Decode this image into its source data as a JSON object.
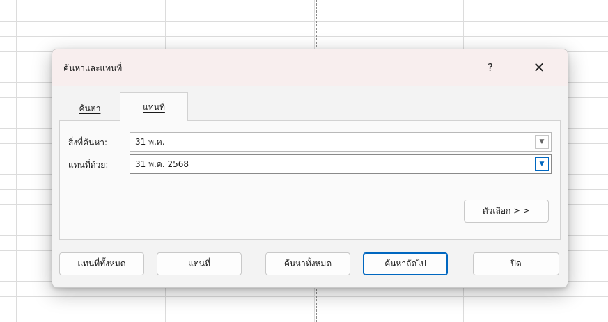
{
  "dialog": {
    "title": "ค้นหาและแทนที่",
    "help_label": "?",
    "close_label": "✕"
  },
  "tabs": [
    {
      "label": "ค้นหา",
      "active": false
    },
    {
      "label": "แทนที่",
      "active": true
    }
  ],
  "find": {
    "label": "สิ่งที่ค้นหา:",
    "value": "31 พ.ค."
  },
  "replace": {
    "label": "แทนที่ด้วย:",
    "value": "31 พ.ค. 2568"
  },
  "options_button": "ตัวเลือก > >",
  "buttons": {
    "replace_all": "แทนที่ทั้งหมด",
    "replace": "แทนที่",
    "find_all": "ค้นหาทั้งหมด",
    "find_next": "ค้นหาถัดไป",
    "close": "ปิด"
  },
  "icons": {
    "dropdown": "chevron-down-icon",
    "close": "close-icon",
    "help": "help-icon"
  },
  "colors": {
    "accent": "#0067c0",
    "titlebar": "#f8eeee",
    "dialog_bg": "#f3f3f3"
  }
}
